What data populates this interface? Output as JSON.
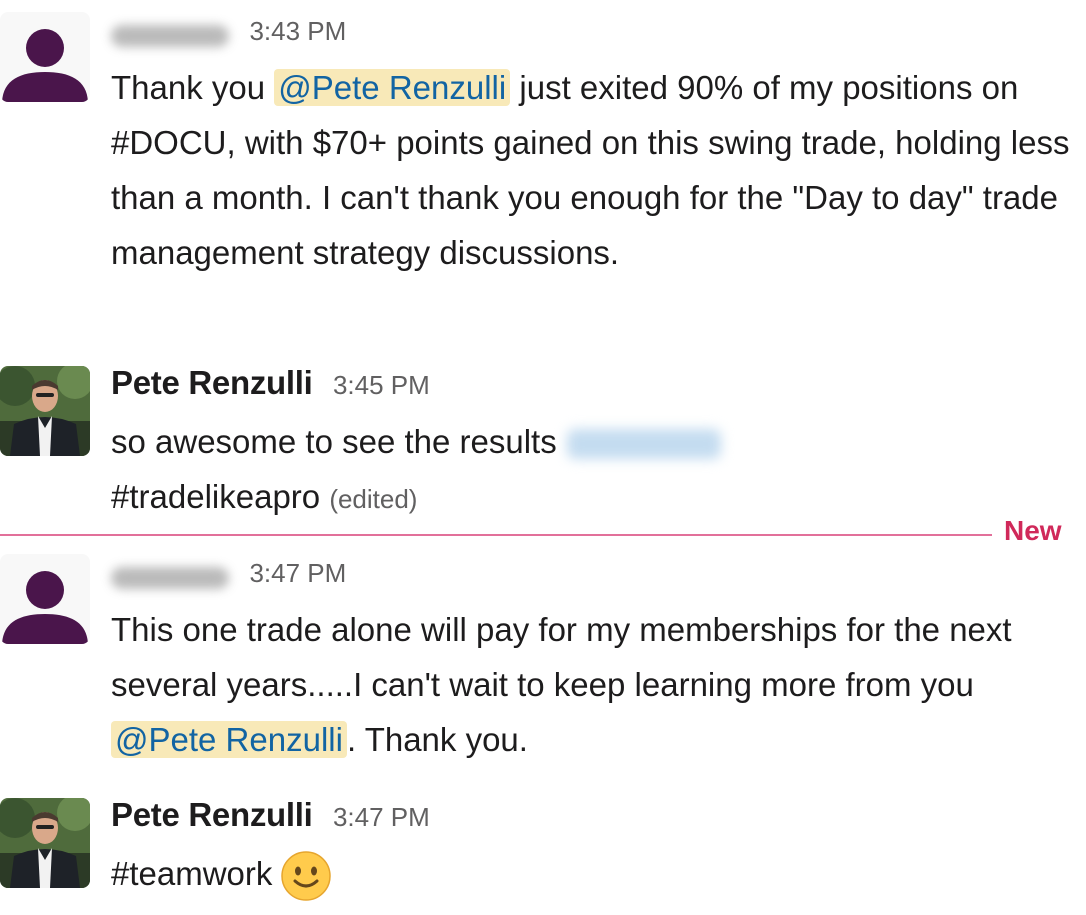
{
  "messages": [
    {
      "author": "",
      "author_blurred": true,
      "avatar": "default-user-avatar",
      "time": "3:43 PM",
      "text_parts": {
        "before_mention": "Thank you ",
        "mention": "@Pete Renzulli",
        "after_mention": " just exited 90% of my positions on #DOCU, with $70+ points gained on this swing trade, holding less than a month.  I can't thank you enough for the \"Day to day\" trade management strategy discussions."
      }
    },
    {
      "author": "Pete Renzulli",
      "avatar": "pete-renzulli-photo",
      "time": "3:45 PM",
      "text_parts": {
        "before_mention": "so awesome to see the results",
        "mention_blurred": true,
        "after_mention": "#tradelikeapro",
        "edited": "(edited)"
      }
    },
    {
      "author": "",
      "author_blurred": true,
      "avatar": "default-user-avatar",
      "time": "3:47 PM",
      "text_parts": {
        "before_mention": "This one trade alone will pay for my memberships for the next several years.....I can't wait to keep learning more from you ",
        "mention": "@Pete Renzulli",
        "after_mention": ". Thank you."
      }
    },
    {
      "author": "Pete Renzulli",
      "avatar": "pete-renzulli-photo",
      "time": "3:47 PM",
      "text_parts": {
        "before_mention": "#teamwork",
        "emoji": "slightly-smiling-face"
      }
    }
  ],
  "divider": {
    "label": "New",
    "color": "#e2709a",
    "label_color": "#d0295a"
  },
  "colors": {
    "mention_bg": "#f8e9b8",
    "mention_text": "#1264a3",
    "default_avatar": "#4a154b",
    "timestamp": "#616061"
  }
}
